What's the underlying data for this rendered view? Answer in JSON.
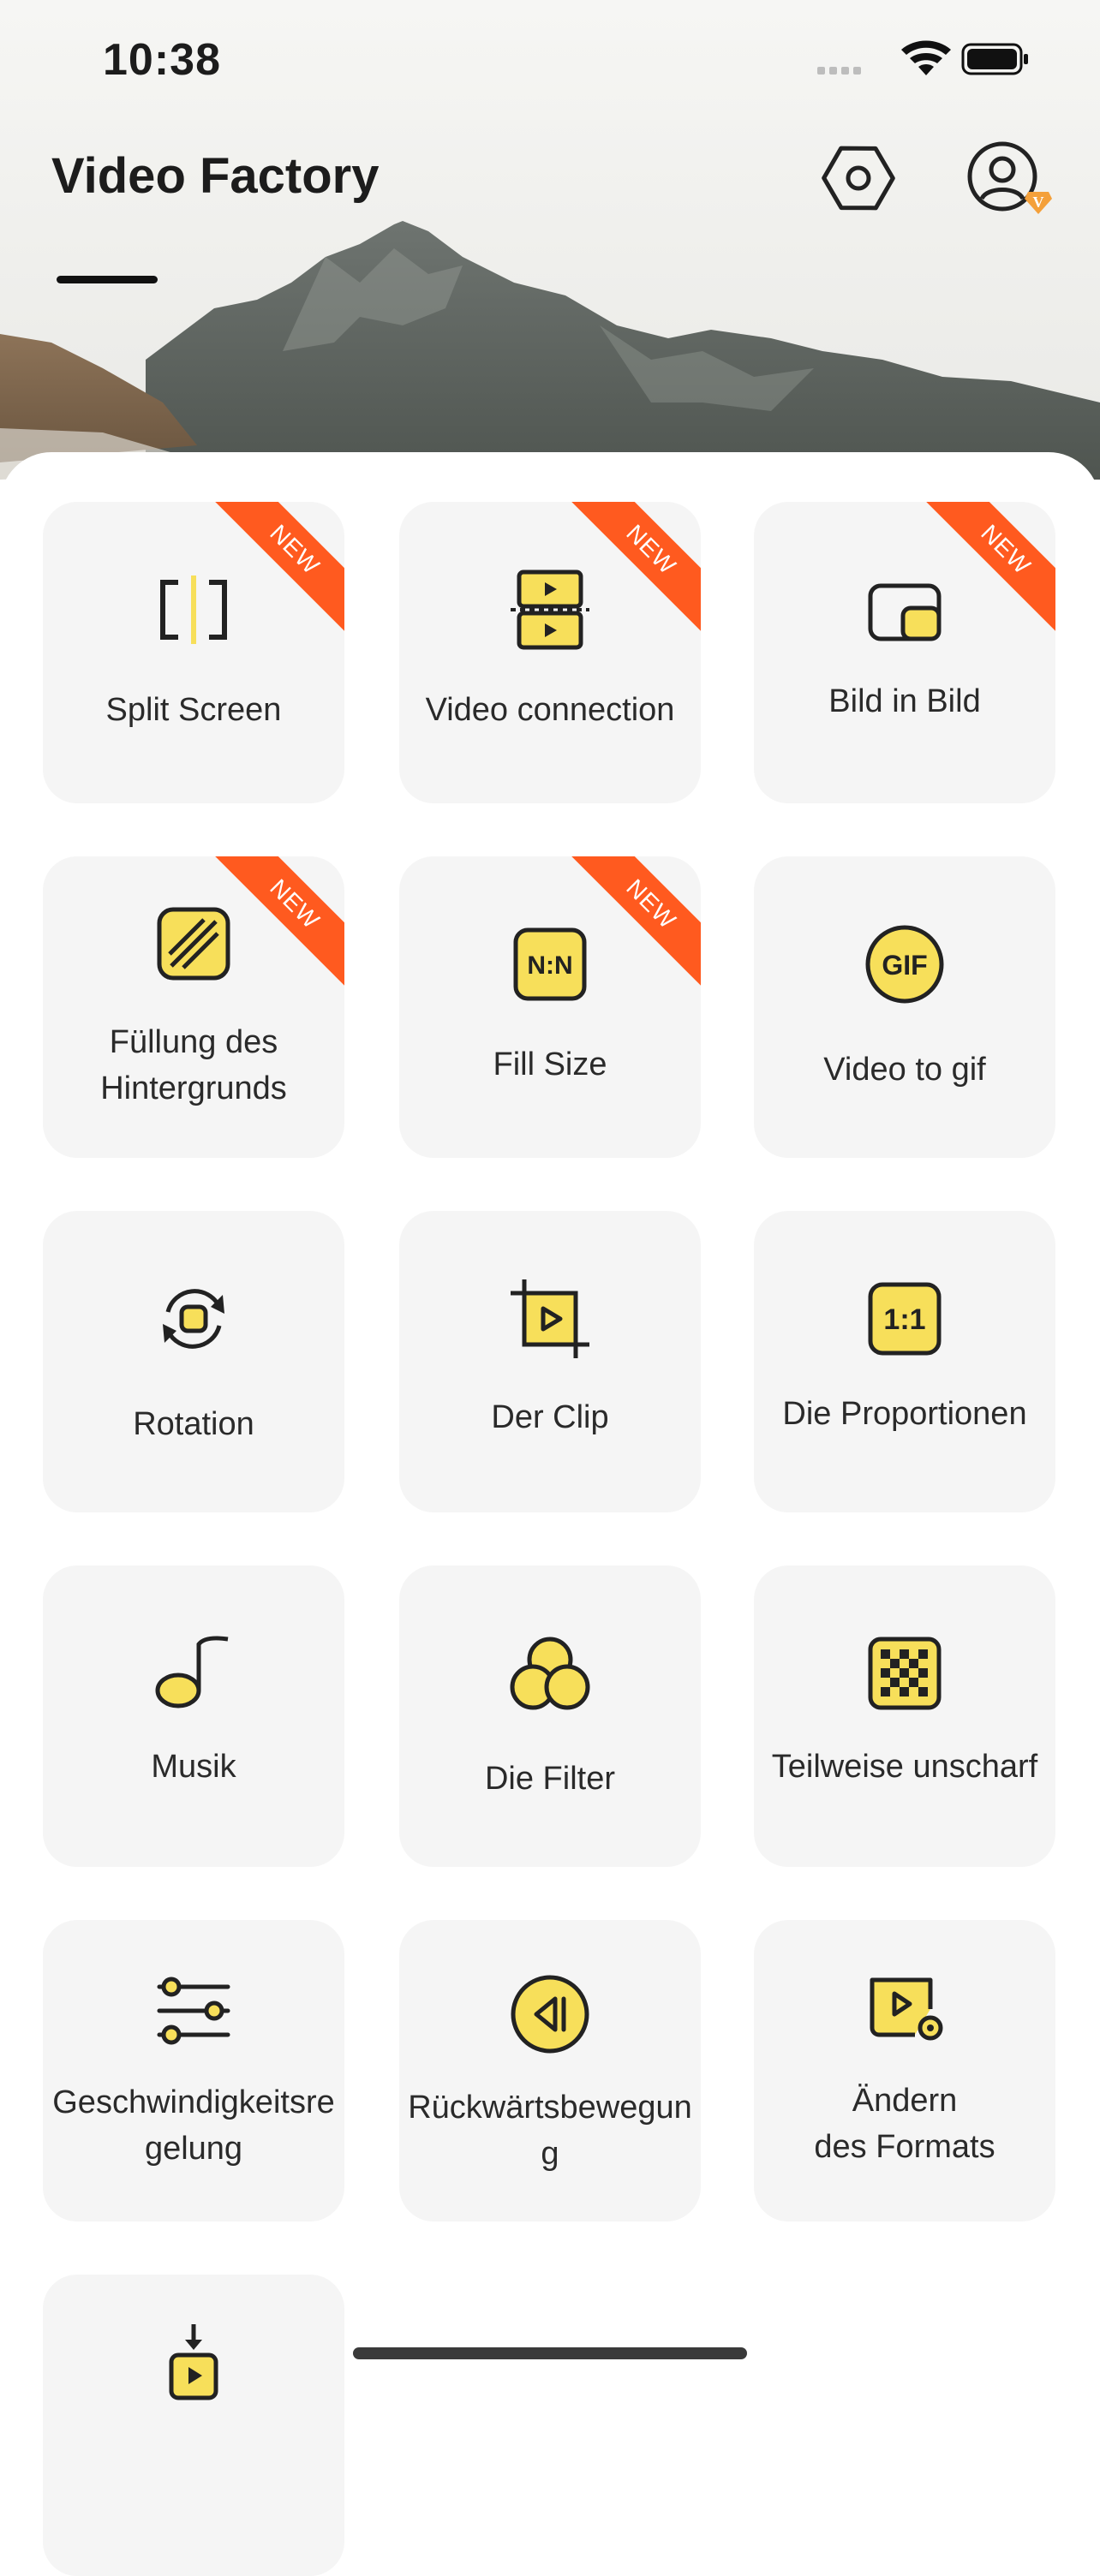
{
  "status_bar": {
    "time": "10:38"
  },
  "header": {
    "title": "Video Factory"
  },
  "tools": [
    {
      "label": "Split Screen",
      "badge": "NEW",
      "icon": "split-screen-icon"
    },
    {
      "label": "Video connection",
      "badge": "NEW",
      "icon": "video-connection-icon"
    },
    {
      "label": "Bild in Bild",
      "badge": "NEW",
      "icon": "picture-in-picture-icon"
    },
    {
      "label": "Füllung des\nHintergrunds",
      "badge": "NEW",
      "icon": "background-fill-icon"
    },
    {
      "label": "Fill Size",
      "badge": "NEW",
      "icon": "fill-size-icon"
    },
    {
      "label": "Video to gif",
      "badge": "",
      "icon": "gif-icon"
    },
    {
      "label": "Rotation",
      "badge": "",
      "icon": "rotation-icon"
    },
    {
      "label": "Der Clip",
      "badge": "",
      "icon": "crop-clip-icon"
    },
    {
      "label": "Die Proportionen",
      "badge": "",
      "icon": "aspect-ratio-icon"
    },
    {
      "label": "Musik",
      "badge": "",
      "icon": "music-note-icon"
    },
    {
      "label": "Die Filter",
      "badge": "",
      "icon": "filters-icon"
    },
    {
      "label": "Teilweise unscharf",
      "badge": "",
      "icon": "mosaic-blur-icon"
    },
    {
      "label": "Geschwindigkeitsre\ngelung",
      "badge": "",
      "icon": "speed-sliders-icon"
    },
    {
      "label": "Rückwärtsbewegun\ng",
      "badge": "",
      "icon": "reverse-icon"
    },
    {
      "label": "Ändern\ndes Formats",
      "badge": "",
      "icon": "format-change-icon"
    },
    {
      "label": "",
      "badge": "",
      "icon": "compress-icon"
    }
  ],
  "colors": {
    "accent_yellow": "#f7df5a",
    "badge_orange": "#ff5a1f",
    "card_bg": "#f5f5f5",
    "vip_orange": "#f4a03a"
  }
}
